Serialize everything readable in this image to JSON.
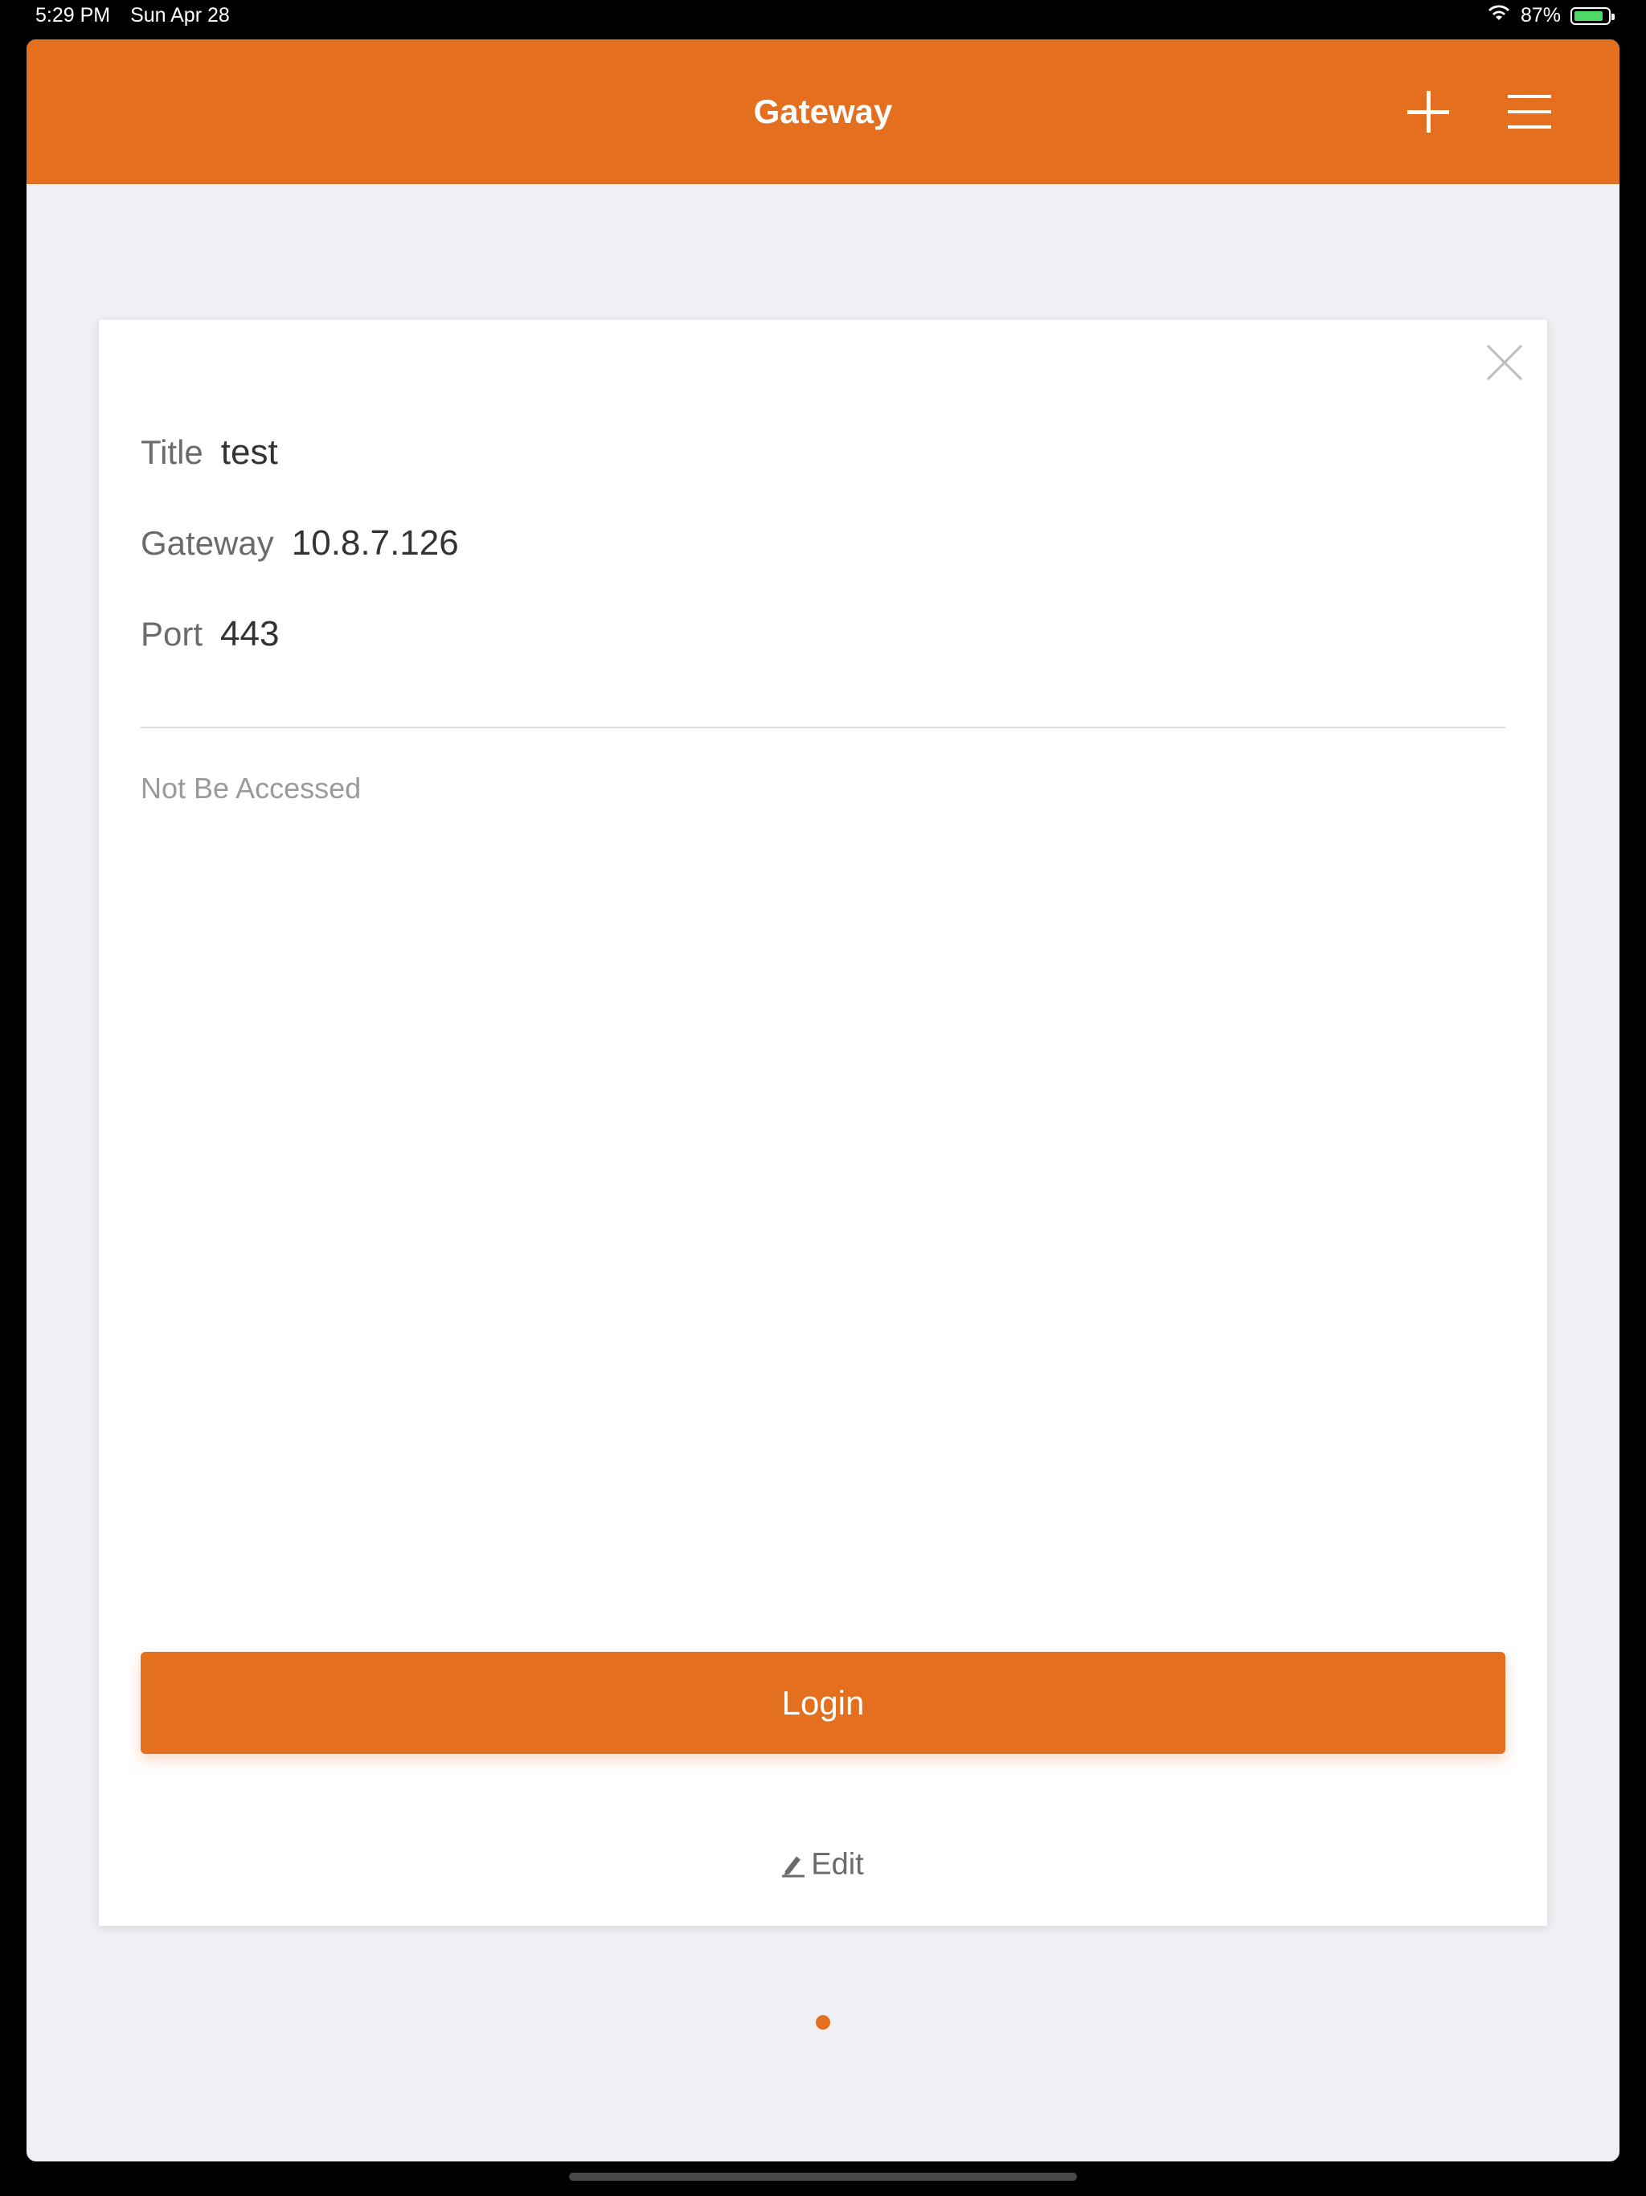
{
  "status_bar": {
    "time": "5:29 PM",
    "date": "Sun Apr 28",
    "battery_text": "87%",
    "battery_level": 0.87,
    "wifi_icon": "wifi-icon"
  },
  "nav": {
    "title": "Gateway",
    "add_icon": "plus-icon",
    "menu_icon": "hamburger-menu-icon"
  },
  "card": {
    "close_icon": "close-icon",
    "fields": {
      "title": {
        "label": "Title",
        "value": "test"
      },
      "gateway": {
        "label": "Gateway",
        "value": "10.8.7.126"
      },
      "port": {
        "label": "Port",
        "value": "443"
      }
    },
    "status": "Not Be Accessed",
    "login_label": "Login",
    "edit_label": "Edit",
    "edit_icon": "pencil-icon"
  },
  "pagination": {
    "current": 1,
    "total": 1
  },
  "colors": {
    "accent": "#e46f1f",
    "background": "#efeff4",
    "card": "#ffffff",
    "battery_green": "#4cd964"
  }
}
